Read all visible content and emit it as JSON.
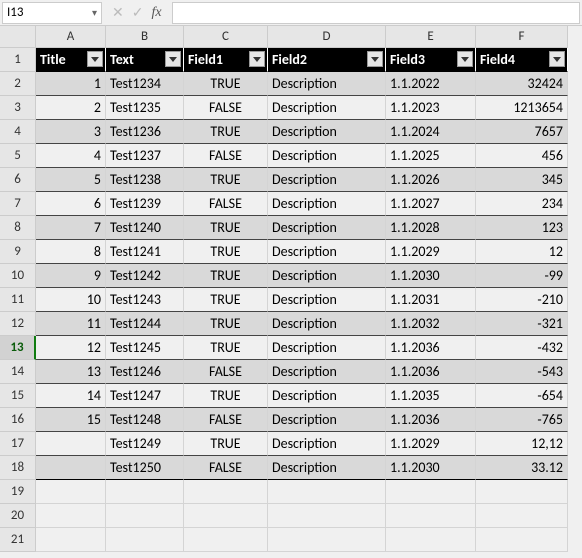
{
  "nameBox": "I13",
  "formula": "",
  "columns": [
    "A",
    "B",
    "C",
    "D",
    "E",
    "F"
  ],
  "rowCount": 21,
  "selectedRow": 13,
  "headers": [
    "Title",
    "Text",
    "Field1",
    "Field2",
    "Field3",
    "Field4"
  ],
  "chart_data": {
    "type": "table",
    "columns": [
      "Title",
      "Text",
      "Field1",
      "Field2",
      "Field3",
      "Field4"
    ],
    "rows": [
      [
        "1",
        "Test1234",
        "TRUE",
        "Description",
        "1.1.2022",
        "32424"
      ],
      [
        "2",
        "Test1235",
        "FALSE",
        "Description",
        "1.1.2023",
        "1213654"
      ],
      [
        "3",
        "Test1236",
        "TRUE",
        "Description",
        "1.1.2024",
        "7657"
      ],
      [
        "4",
        "Test1237",
        "FALSE",
        "Description",
        "1.1.2025",
        "456"
      ],
      [
        "5",
        "Test1238",
        "TRUE",
        "Description",
        "1.1.2026",
        "345"
      ],
      [
        "6",
        "Test1239",
        "FALSE",
        "Description",
        "1.1.2027",
        "234"
      ],
      [
        "7",
        "Test1240",
        "TRUE",
        "Description",
        "1.1.2028",
        "123"
      ],
      [
        "8",
        "Test1241",
        "TRUE",
        "Description",
        "1.1.2029",
        "12"
      ],
      [
        "9",
        "Test1242",
        "TRUE",
        "Description",
        "1.1.2030",
        "-99"
      ],
      [
        "10",
        "Test1243",
        "TRUE",
        "Description",
        "1.1.2031",
        "-210"
      ],
      [
        "11",
        "Test1244",
        "TRUE",
        "Description",
        "1.1.2032",
        "-321"
      ],
      [
        "12",
        "Test1245",
        "TRUE",
        "Description",
        "1.1.2036",
        "-432"
      ],
      [
        "13",
        "Test1246",
        "FALSE",
        "Description",
        "1.1.2036",
        "-543"
      ],
      [
        "14",
        "Test1247",
        "TRUE",
        "Description",
        "1.1.2035",
        "-654"
      ],
      [
        "15",
        "Test1248",
        "FALSE",
        "Description",
        "1.1.2036",
        "-765"
      ],
      [
        "",
        "Test1249",
        "TRUE",
        "Description",
        "1.1.2029",
        "12,12"
      ],
      [
        "",
        "Test1250",
        "FALSE",
        "Description",
        "1.1.2030",
        "33.12"
      ]
    ]
  }
}
